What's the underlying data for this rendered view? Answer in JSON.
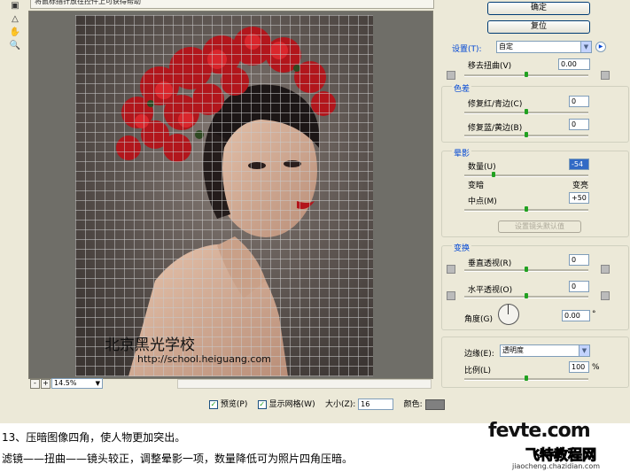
{
  "hint_text": "将鼠标指针放在控件上可获得帮助",
  "watermark": {
    "line1": "北京黑光学校",
    "line2": "http://school.heiguang.com"
  },
  "zoom": {
    "minus": "-",
    "plus": "+",
    "value": "14.5%"
  },
  "options": {
    "preview_label": "预览(P)",
    "show_grid_label": "显示网格(W)",
    "size_label": "大小(Z):",
    "size_value": "16",
    "color_label": "颜色:",
    "grid_color": "#808080"
  },
  "buttons": {
    "ok": "确定",
    "reset": "复位"
  },
  "settings": {
    "label": "设置(T):",
    "value": "自定"
  },
  "remove_distortion": {
    "label": "移去扭曲(V)",
    "value": "0.00",
    "slider_fraction": 0.5
  },
  "chromatic": {
    "title": "色差",
    "red_cyan": {
      "label": "修复红/青边(C)",
      "value": "0",
      "slider_fraction": 0.5
    },
    "blue_yellow": {
      "label": "修复蓝/黄边(B)",
      "value": "0",
      "slider_fraction": 0.5
    }
  },
  "vignette": {
    "title": "晕影",
    "amount": {
      "label": "数量(U)",
      "value": "-54",
      "slider_fraction": 0.23
    },
    "darken_label": "变暗",
    "lighten_label": "变亮",
    "midpoint": {
      "label": "中点(M)",
      "value": "+50",
      "slider_fraction": 0.5
    },
    "lens_default_button": "设置镜头默认值"
  },
  "transform": {
    "title": "变换",
    "vertical": {
      "label": "垂直透视(R)",
      "value": "0",
      "slider_fraction": 0.5
    },
    "horizontal": {
      "label": "水平透视(O)",
      "value": "0",
      "slider_fraction": 0.5
    },
    "angle": {
      "label": "角度(G)",
      "value": "0.00",
      "unit": "°"
    }
  },
  "edge": {
    "label": "边缘(E):",
    "value": "透明度"
  },
  "scale": {
    "label": "比例(L)",
    "value": "100",
    "unit": "%",
    "slider_fraction": 0.5
  },
  "caption": {
    "line1": "13、压暗图像四角，使人物更加突出。",
    "line2": "滤镜——扭曲——镜头较正，调整晕影一项，数量降低可为照片四角压暗。"
  },
  "site_logo": {
    "name": "fevte.com",
    "cn": "飞特教程网",
    "url": "jiaocheng.chazidian.com"
  },
  "colors": {
    "accent": "#0046d5",
    "slider_thumb": "#21a121",
    "dialog_bg": "#ece9d8"
  }
}
